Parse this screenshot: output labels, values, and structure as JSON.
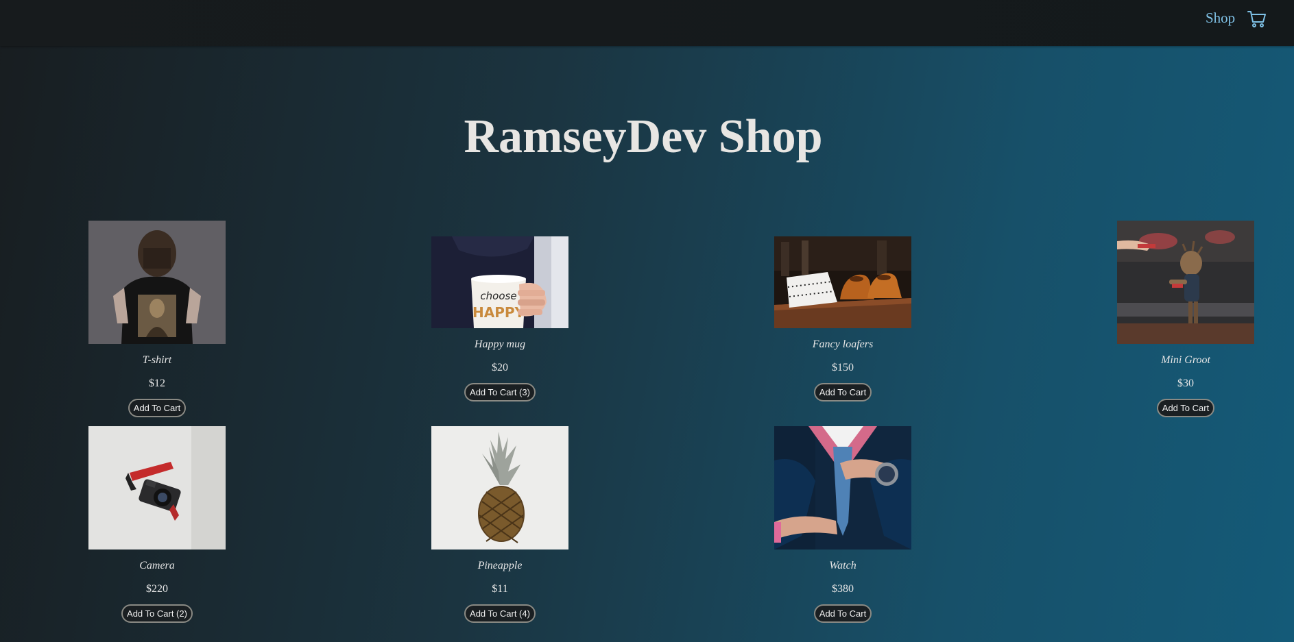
{
  "nav": {
    "shop_label": "Shop",
    "cart_icon": "shopping-cart-icon"
  },
  "title": "RamseyDev Shop",
  "products": [
    {
      "name": "T-shirt",
      "price": "$12",
      "button": "Add To Cart",
      "image": "t-shirt-photo"
    },
    {
      "name": "Happy mug",
      "price": "$20",
      "button": "Add To Cart (3)",
      "image": "happy-mug-photo"
    },
    {
      "name": "Fancy loafers",
      "price": "$150",
      "button": "Add To Cart",
      "image": "fancy-loafers-photo"
    },
    {
      "name": "Mini Groot",
      "price": "$30",
      "button": "Add To Cart",
      "image": "mini-groot-photo"
    },
    {
      "name": "Camera",
      "price": "$220",
      "button": "Add To Cart (2)",
      "image": "camera-photo"
    },
    {
      "name": "Pineapple",
      "price": "$11",
      "button": "Add To Cart (4)",
      "image": "pineapple-photo"
    },
    {
      "name": "Watch",
      "price": "$380",
      "button": "Add To Cart",
      "image": "watch-photo"
    }
  ]
}
